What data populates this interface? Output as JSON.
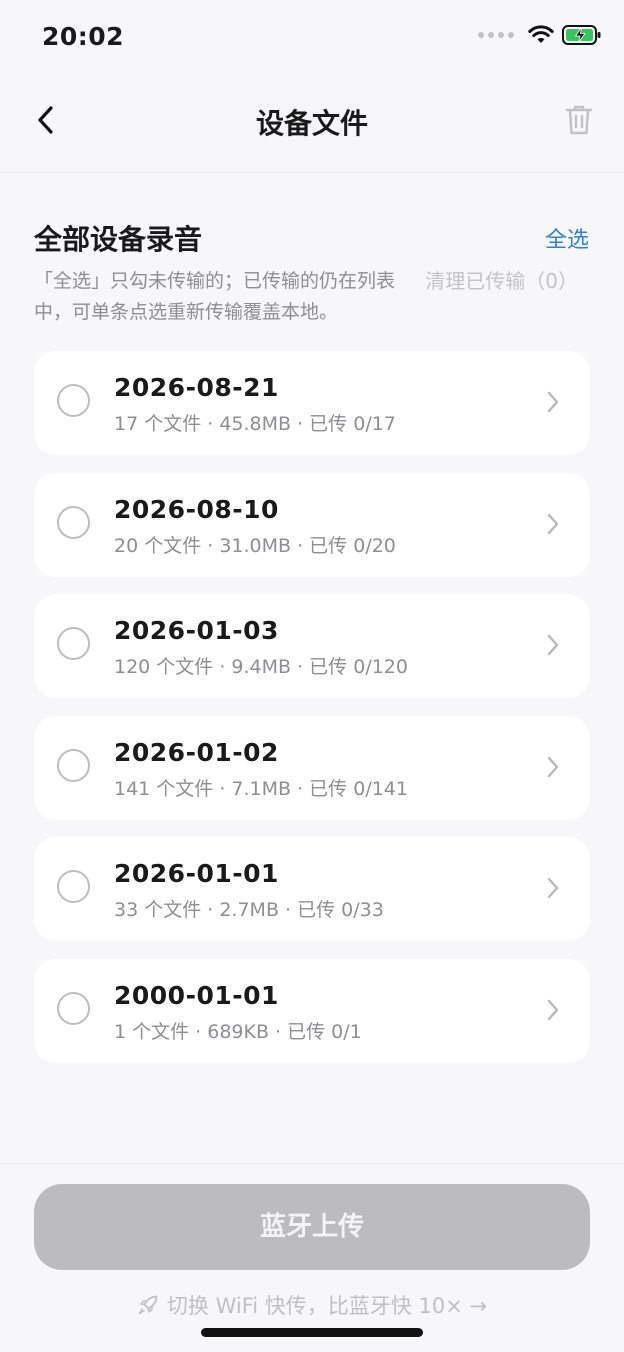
{
  "status_bar": {
    "time": "20:02"
  },
  "nav": {
    "title": "设备文件"
  },
  "section": {
    "title": "全部设备录音",
    "select_all": "全选",
    "hint": "「全选」只勾未传输的；已传输的仍在列表中，可单条点选重新传输覆盖本地。",
    "clear_label": "清理已传输（0）"
  },
  "groups": [
    {
      "date": "2026-08-21",
      "meta": "17 个文件 · 45.8MB · 已传 0/17"
    },
    {
      "date": "2026-08-10",
      "meta": "20 个文件 · 31.0MB · 已传 0/20"
    },
    {
      "date": "2026-01-03",
      "meta": "120 个文件 · 9.4MB · 已传 0/120"
    },
    {
      "date": "2026-01-02",
      "meta": "141 个文件 · 7.1MB · 已传 0/141"
    },
    {
      "date": "2026-01-01",
      "meta": "33 个文件 · 2.7MB · 已传 0/33"
    },
    {
      "date": "2000-01-01",
      "meta": "1 个文件 · 689KB · 已传 0/1"
    }
  ],
  "bottom": {
    "upload_label": "蓝牙上传",
    "wifi_text": "切换 WiFi 快传，比蓝牙快 10× →"
  },
  "colors": {
    "accent": "#2f80d8",
    "battery": "#34c759",
    "disabled_button": "#bcbcbe"
  }
}
